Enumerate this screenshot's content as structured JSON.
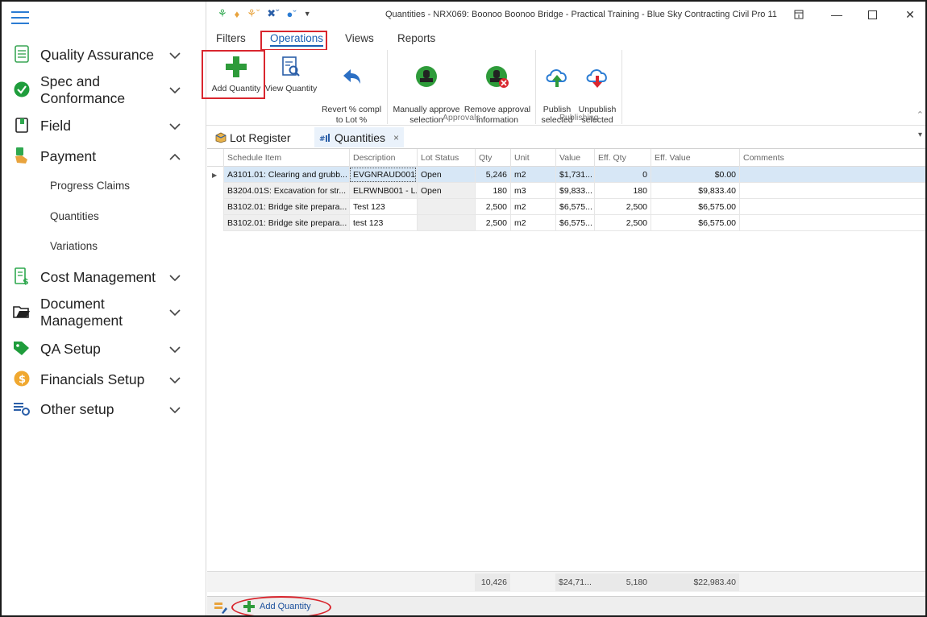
{
  "window": {
    "title": "Quantities - NRX069: Boonoo Boonoo Bridge - Practical Training - Blue Sky Contracting Civil Pro 11"
  },
  "sidebar": {
    "items": [
      {
        "label": "Quality Assurance",
        "icon": "checklist-icon"
      },
      {
        "label": "Spec and\nConformance",
        "icon": "check-circle-icon"
      },
      {
        "label": "Field",
        "icon": "field-book-icon"
      },
      {
        "label": "Payment",
        "icon": "payment-hand-icon"
      },
      {
        "label": "Cost Management",
        "icon": "cost-sheet-icon"
      },
      {
        "label": "Document\nManagement",
        "icon": "folder-icon"
      },
      {
        "label": "QA Setup",
        "icon": "tag-icon"
      },
      {
        "label": "Financials Setup",
        "icon": "dollar-coin-icon"
      },
      {
        "label": "Other setup",
        "icon": "settings-list-icon"
      }
    ],
    "payment_sub": [
      "Progress Claims",
      "Quantities",
      "Variations"
    ]
  },
  "ribbon": {
    "tabs": [
      "Filters",
      "Operations",
      "Views",
      "Reports"
    ],
    "buttons": {
      "add_quantity": "Add Quantity",
      "view_quantity": "View Quantity",
      "revert": "Revert % compl\nto Lot %",
      "manually_approve": "Manually approve\nselection",
      "remove_approval": "Remove approval\ninformation",
      "publish": "Publish\nselected",
      "unpublish": "Unpublish\nselected"
    },
    "groups": {
      "approvals": "Approvals",
      "publishing": "Publishing"
    }
  },
  "doc_tabs": {
    "lot_register": "Lot Register",
    "quantities": "Quantities",
    "close": "×"
  },
  "grid": {
    "columns": [
      "Schedule Item",
      "Description",
      "Lot Status",
      "Qty",
      "Unit",
      "Value",
      "Eff. Qty",
      "Eff. Value",
      "Comments"
    ],
    "rows": [
      [
        "A3101.01: Clearing and grubb...",
        "EVGNRAUD001 ...",
        "Open",
        "5,246",
        "m2",
        "$1,731...",
        "0",
        "$0.00",
        ""
      ],
      [
        "B3204.01S: Excavation for str...",
        "ELRWNB001 - L...",
        "Open",
        "180",
        "m3",
        "$9,833...",
        "180",
        "$9,833.40",
        ""
      ],
      [
        "B3102.01: Bridge site prepara...",
        "Test 123",
        "",
        "2,500",
        "m2",
        "$6,575...",
        "2,500",
        "$6,575.00",
        ""
      ],
      [
        "B3102.01: Bridge site prepara...",
        "test 123",
        "",
        "2,500",
        "m2",
        "$6,575...",
        "2,500",
        "$6,575.00",
        ""
      ]
    ],
    "totals": {
      "qty": "10,426",
      "value": "$24,71...",
      "eff_qty": "5,180",
      "eff_value": "$22,983.40"
    }
  },
  "bottombar": {
    "add_quantity": "Add Quantity"
  },
  "colors": {
    "accent": "#1a5fb4",
    "highlight": "#d9262e",
    "selected_row": "#d7e7f6",
    "add_green": "#2e9b3a"
  }
}
